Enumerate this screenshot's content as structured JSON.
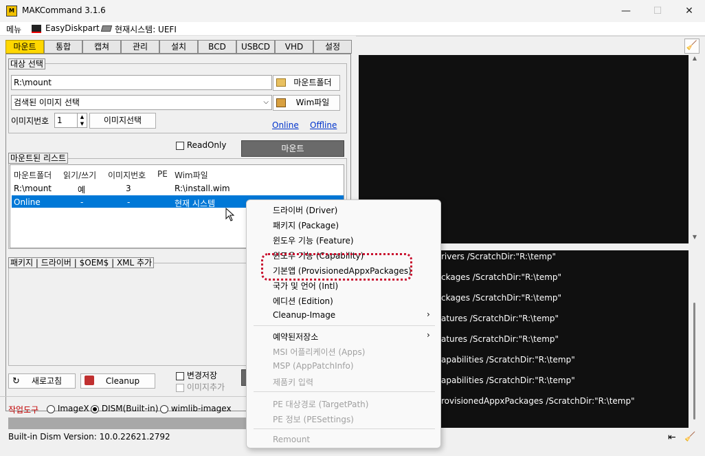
{
  "window": {
    "title": "MAKCommand 3.1.6",
    "minimize": "—",
    "maximize": "☐",
    "close": "✕"
  },
  "menu": {
    "item1": "메뉴",
    "item2": "EasyDiskpart",
    "item3": "현재시스템: UEFI"
  },
  "tabs": [
    "마운트",
    "통합",
    "캡쳐",
    "관리",
    "설치",
    "BCD",
    "USBCD",
    "VHD",
    "설정"
  ],
  "target": {
    "group_label": "대상 선택",
    "mount_path": "R:\\mount",
    "mount_folder_btn": "마운트폴더",
    "image_select": "검색된 이미지 선택",
    "wim_btn": "Wim파일",
    "image_number_label": "이미지번호",
    "image_number": "1",
    "image_select_btn": "이미지선택",
    "online": "Online",
    "offline": "Offline",
    "readonly": "ReadOnly",
    "mount_btn": "마운트"
  },
  "mounted": {
    "group_label": "마운트된 리스트",
    "headers": [
      "마운트폴더",
      "읽기/쓰기",
      "이미지번호",
      "PE",
      "Wim파일"
    ],
    "rows": [
      [
        "R:\\mount",
        "예",
        "3",
        "",
        "R:\\install.wim"
      ],
      [
        "Online",
        "-",
        "-",
        "",
        "현재 시스템"
      ]
    ]
  },
  "addons": {
    "group_label": "패키지 | 드라이버 | $OEM$ | XML 추가"
  },
  "bottom": {
    "refresh_btn": "새로고침",
    "cleanup_btn": "Cleanup",
    "save_changes": "변경저장",
    "add_image": "이미지추가",
    "tool_label": "작업도구",
    "opt_imagex": "ImageX",
    "opt_dism": "DISM(Built-in)",
    "opt_wimlib": "wimlib-imagex",
    "status": "Built-in Dism Version: 10.0.22621.2792"
  },
  "log_lines": [
    "rivers /ScratchDir:\"R:\\temp\"",
    "ckages /ScratchDir:\"R:\\temp\"",
    "ckages /ScratchDir:\"R:\\temp\"",
    "atures /ScratchDir:\"R:\\temp\"",
    "atures /ScratchDir:\"R:\\temp\"",
    "apabilities /ScratchDir:\"R:\\temp\"",
    "apabilities /ScratchDir:\"R:\\temp\"",
    "rovisionedAppxPackages /ScratchDir:\"R:\\temp\""
  ],
  "context_menu": {
    "items": [
      {
        "label": "드라이버 (Driver)"
      },
      {
        "label": "패키지 (Package)"
      },
      {
        "label": "윈도우 기능 (Feature)"
      },
      {
        "label": "윈도우 기능 (Capability)"
      },
      {
        "label": "기본앱 (ProvisionedAppxPackages)"
      },
      {
        "label": "국가 및 언어 (Intl)"
      },
      {
        "label": "에디션 (Edition)"
      },
      {
        "label": "Cleanup-Image"
      },
      {
        "label": "예약된저장소"
      },
      {
        "label": "MSI 어플리케이션 (Apps)"
      },
      {
        "label": "MSP (AppPatchInfo)"
      },
      {
        "label": "제품키 입력"
      },
      {
        "label": "PE 대상경로 (TargetPath)"
      },
      {
        "label": "PE 정보 (PESettings)"
      },
      {
        "label": "Remount"
      }
    ],
    "submenu_arrow": "›"
  },
  "colors": {
    "active_tab": "#ffd700",
    "selection": "#0078d7",
    "highlight_ring": "#c8102e",
    "console_bg": "#101010"
  }
}
